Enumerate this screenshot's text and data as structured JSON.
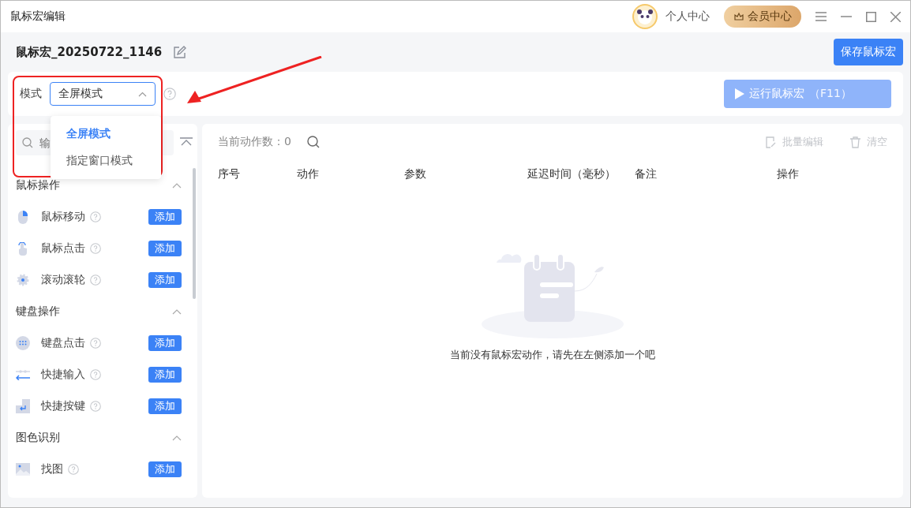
{
  "window": {
    "title": "鼠标宏编辑",
    "user_label": "个人中心",
    "vip_label": "会员中心"
  },
  "macro": {
    "name": "鼠标宏_20250722_1146"
  },
  "save_button": "保存鼠标宏",
  "mode": {
    "label": "模式",
    "value": "全屏模式",
    "expanded": true,
    "options": [
      {
        "label": "全屏模式",
        "selected": true
      },
      {
        "label": "指定窗口模式",
        "selected": false
      }
    ]
  },
  "run_button": {
    "label": "运行鼠标宏",
    "shortcut": "（F11）",
    "disabled": true
  },
  "sidebar": {
    "search_placeholder": "输",
    "groups": [
      {
        "title": "鼠标操作",
        "expanded": true,
        "items": [
          {
            "label": "鼠标移动",
            "kind": "mouse",
            "action": "添加"
          },
          {
            "label": "鼠标点击",
            "kind": "pointer",
            "action": "添加"
          },
          {
            "label": "滚动滚轮",
            "kind": "wheel",
            "action": "添加"
          }
        ]
      },
      {
        "title": "键盘操作",
        "expanded": true,
        "items": [
          {
            "label": "键盘点击",
            "kind": "keyboard",
            "action": "添加"
          },
          {
            "label": "快捷输入",
            "kind": "input",
            "action": "添加"
          },
          {
            "label": "快捷按键",
            "kind": "enter",
            "action": "添加"
          }
        ]
      },
      {
        "title": "图色识别",
        "expanded": true,
        "items": [
          {
            "label": "找图",
            "kind": "image",
            "action": "添加"
          }
        ]
      }
    ]
  },
  "actions": {
    "count_label": "当前动作数：",
    "count": "0",
    "batch_edit": "批量编辑",
    "clear": "清空"
  },
  "table": {
    "columns": [
      "序号",
      "动作",
      "参数",
      "延迟时间（毫秒）",
      "备注",
      "操作"
    ]
  },
  "empty_message": "当前没有鼠标宏动作，请先在左侧添加一个吧"
}
